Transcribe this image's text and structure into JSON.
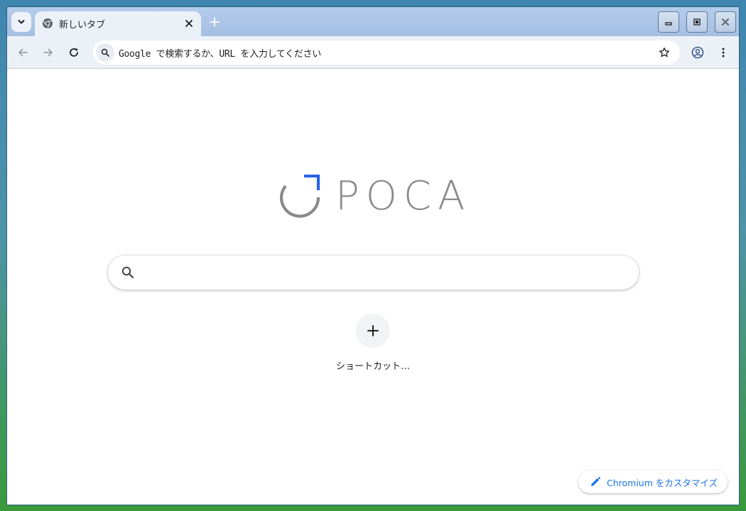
{
  "tabstrip": {
    "tab_title": "新しいタブ",
    "icons": {
      "tab_search": "chevron-down-icon",
      "favicon": "chrome-icon",
      "close": "close-icon",
      "new_tab": "plus-icon"
    }
  },
  "window_controls": {
    "icons": [
      "minimize-icon",
      "maximize-icon",
      "close-icon"
    ]
  },
  "toolbar": {
    "omnibox_text": "Google で検索するか、URL を入力してください",
    "icons": [
      "back-icon",
      "forward-icon",
      "reload-icon",
      "search-icon",
      "star-icon",
      "profile-icon",
      "menu-icon"
    ]
  },
  "ntp": {
    "logo_text": "POCA",
    "search_placeholder": "",
    "shortcut_label": "ショートカット…",
    "customize_label": "Chromium をカスタマイズ"
  },
  "colors": {
    "accent": "#1a73e8",
    "logo_gray": "#8a8a8a",
    "logo_blue": "#2962e8",
    "tabstrip": "#aac4e6",
    "toolbar": "#ecf1f8"
  }
}
